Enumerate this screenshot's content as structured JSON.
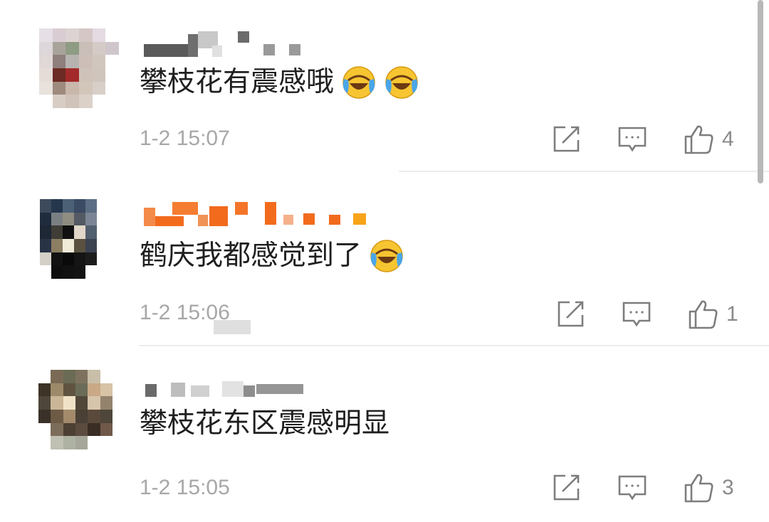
{
  "comments": [
    {
      "text": "攀枝花有震感哦",
      "emojis": [
        "laugh-cry-emoji",
        "laugh-cry-emoji"
      ],
      "time": "1-2 15:07",
      "likes": "4"
    },
    {
      "text": "鹤庆我都感觉到了",
      "emojis": [
        "laugh-cry-emoji"
      ],
      "time": "1-2 15:06",
      "likes": "1"
    },
    {
      "text": "攀枝花东区震感明显",
      "emojis": [],
      "time": "1-2 15:05",
      "likes": "3"
    }
  ],
  "icons": {
    "share": "share-icon",
    "reply": "comment-icon",
    "like": "thumbs-up-icon"
  },
  "colors": {
    "text": "#1f1f1f",
    "meta": "#a7a7a7",
    "icon": "#7d7d7d",
    "username_2": "#f26b1d"
  }
}
